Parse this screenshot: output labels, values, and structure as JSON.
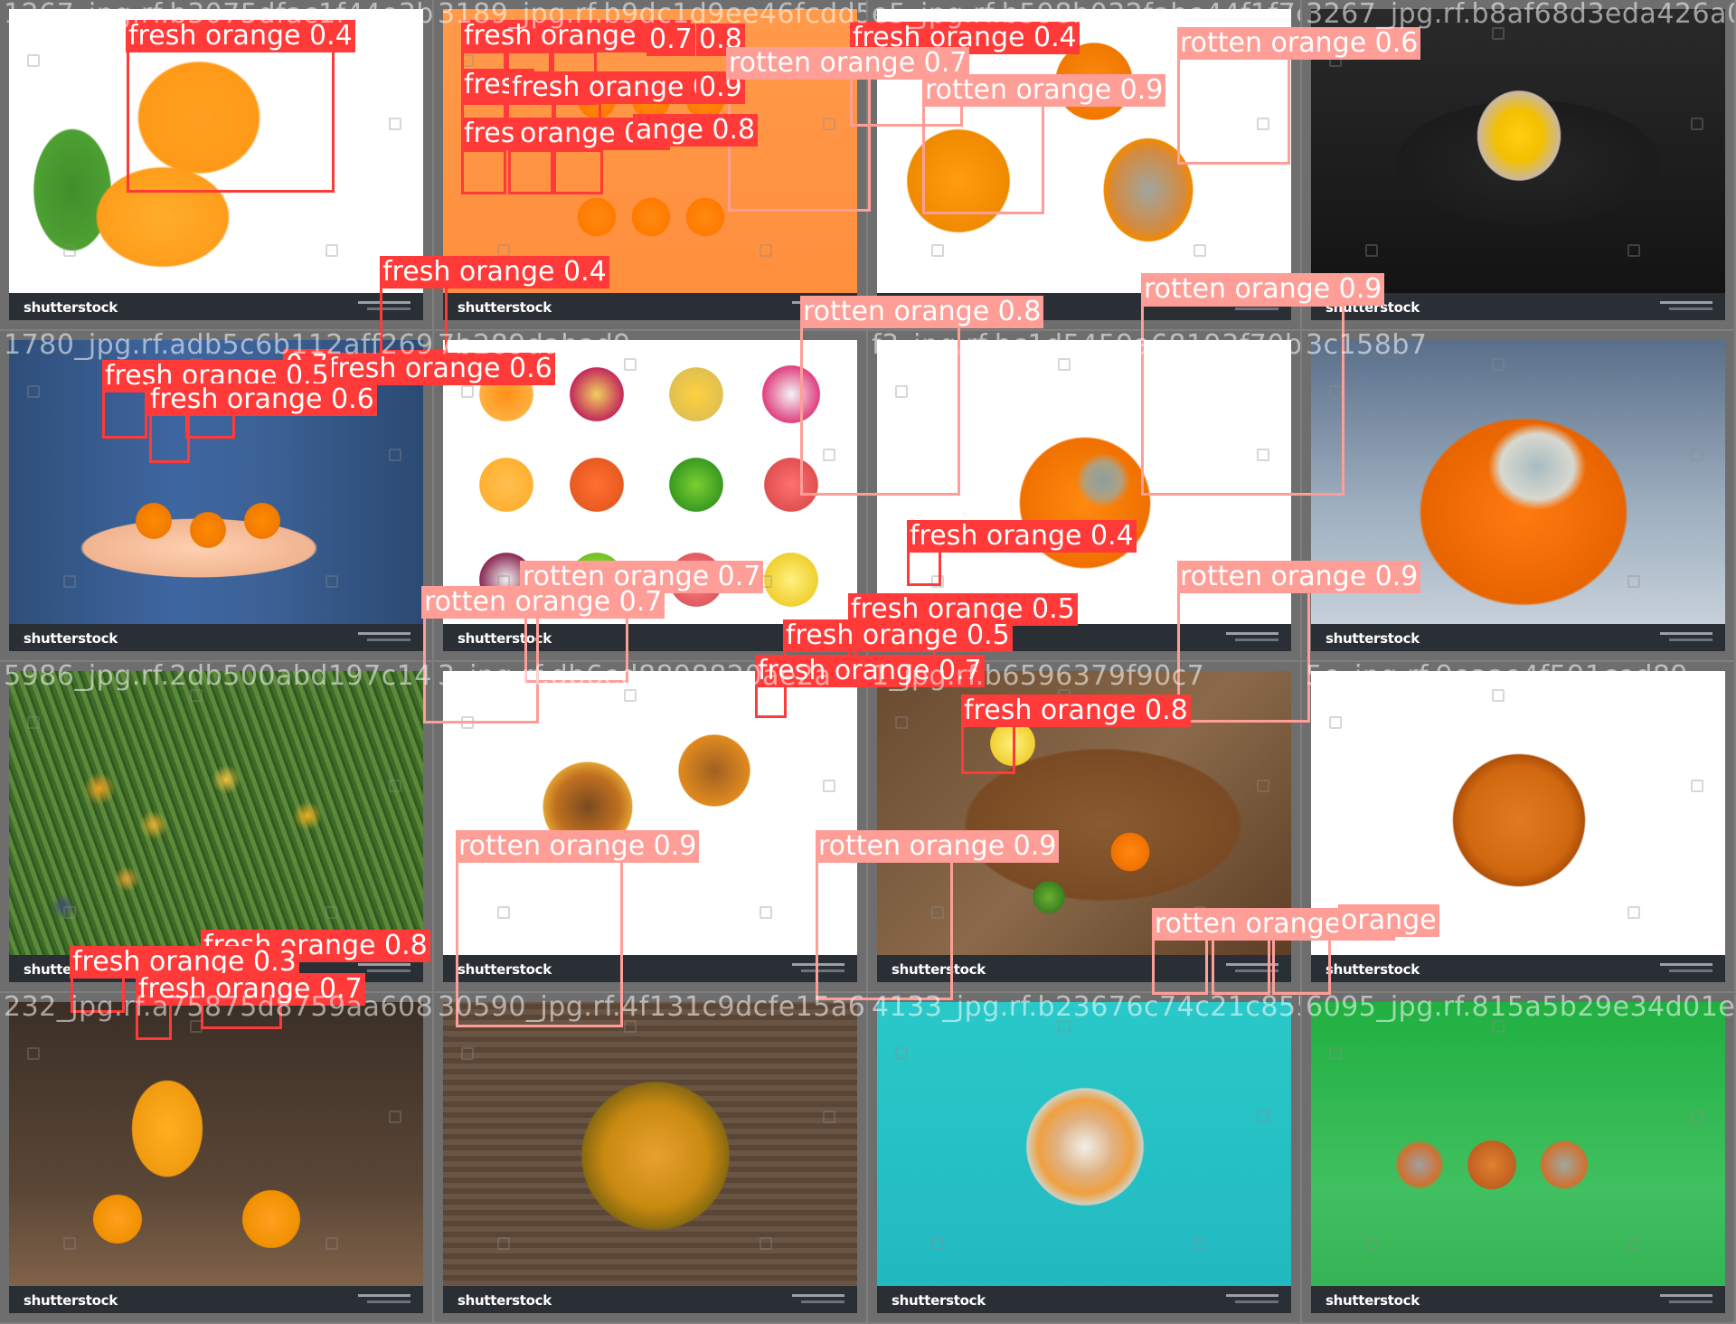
{
  "footer_brand": "shutterstock",
  "colors": {
    "fresh_box": "#ff3a38",
    "rotten_box": "#ff9d97",
    "label_text": "#ffffff",
    "mosaic_bg": "#7f7f7f"
  },
  "tiles": [
    {
      "filename": "1267_jpg.rf.b3075dfac1f44e3b6c91379a",
      "labels": [
        "fresh orange 0.4"
      ]
    },
    {
      "filename": "3189_jpg.rf.b9dc1d9ee46fcdd50c8925",
      "labels": [
        "fresh orange 0.5",
        "0.7",
        "0.8",
        "fresh",
        "fresh orange 0.3",
        "0.9",
        "fresh",
        "orange 0.7",
        "ange 0.8"
      ]
    },
    {
      "filename": "e5_jpg.rf.b598b032fabe44f1f7c5ab",
      "labels": [
        "fresh orange 0.4",
        "rotten orange 0.7",
        "rotten orange 0.9"
      ]
    },
    {
      "filename": "3267_jpg.rf.b8af68d3eda426a0f",
      "labels": [
        "rotten orange 0.6"
      ]
    },
    {
      "filename": "1780_jpg.rf.adb5c6b112aff2696747",
      "labels": [
        "fresh orange 0.6",
        "0.7",
        "fresh orange 0.5",
        "fresh orange 0.6"
      ]
    },
    {
      "filename": "7b289dabad9",
      "labels": [
        "fresh orange 0.4"
      ]
    },
    {
      "filename": "f3_jpg.rf.bc1d5459a68193f70b8306",
      "labels": [
        "rotten orange 0.8"
      ]
    },
    {
      "filename": "3c158b7",
      "labels": [
        "rotten orange 0.9"
      ]
    },
    {
      "filename": "5986_jpg.rf.2db500abd197c145f655",
      "labels": []
    },
    {
      "filename": "3_jpg.rf.db6ed8898820ae2a",
      "labels": [
        "rotten orange 0.7",
        "rotten orange 0.7"
      ]
    },
    {
      "filename": "1_jpg.rf.b6596379f90c7",
      "labels": [
        "fresh orange 0.4",
        "fresh orange 0.5",
        "fresh orange 0.5",
        "fresh orange 0.7",
        "fresh orange 0.8"
      ]
    },
    {
      "filename": "5e_jpg.rf.9eaae4f591ced89",
      "labels": [
        "rotten orange 0.9"
      ]
    },
    {
      "filename": "232_jpg.rf.a75875d8759aa608b",
      "labels": [
        "fresh orange 0.8",
        "fresh orange 0.3",
        "fresh orange 0.7"
      ]
    },
    {
      "filename": "30590_jpg.rf.4f131c9dcfe15a6b1b",
      "labels": [
        "rotten orange 0.9"
      ]
    },
    {
      "filename": "4133_jpg.rf.b23676c74c21c85523",
      "labels": [
        "rotten orange 0.9"
      ]
    },
    {
      "filename": "6095_jpg.rf.815a5b29e34d01e8",
      "labels": [
        "rotten orange 0.8",
        "orange"
      ]
    }
  ]
}
